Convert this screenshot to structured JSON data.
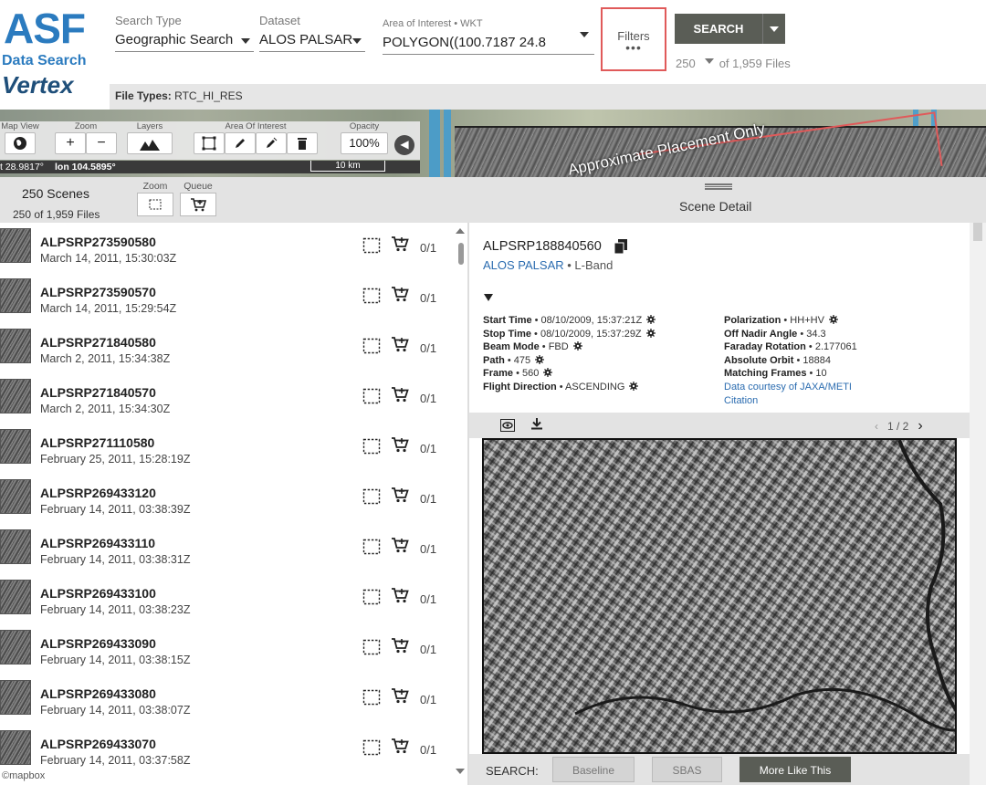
{
  "logo": {
    "asf": "ASF",
    "data_search": "Data Search",
    "vertex": "Vertex"
  },
  "header": {
    "search_type_label": "Search Type",
    "search_type_value": "Geographic Search",
    "dataset_label": "Dataset",
    "dataset_value": "ALOS PALSAR",
    "aoi_label": "Area of Interest • WKT",
    "aoi_value": "POLYGON((100.7187 24.8",
    "filters_label": "Filters",
    "filters_dots": "•••",
    "search_label": "SEARCH",
    "per_page": "250",
    "total_files": "of 1,959 Files",
    "file_types_label": "File Types:",
    "file_types_value": "RTC_HI_RES"
  },
  "map": {
    "toolbar_labels": {
      "map_view": "Map View",
      "zoom": "Zoom",
      "layers": "Layers",
      "aoi": "Area Of Interest",
      "opacity": "Opacity"
    },
    "zoom_in": "+",
    "zoom_out": "−",
    "opacity_value": "100%",
    "lat": "t 28.9817°",
    "lon": "lon 104.5895°",
    "scale": "10 km",
    "approx_text": "Approximate Placement Only"
  },
  "list_header": {
    "scene_count": "250 Scenes",
    "files_count": "250 of 1,959 Files",
    "zoom_label": "Zoom",
    "queue_label": "Queue",
    "detail_title": "Scene Detail"
  },
  "scenes": [
    {
      "name": "ALPSRP273590580",
      "date": "March 14, 2011, 15:30:03Z",
      "queue": "0/1"
    },
    {
      "name": "ALPSRP273590570",
      "date": "March 14, 2011, 15:29:54Z",
      "queue": "0/1"
    },
    {
      "name": "ALPSRP271840580",
      "date": "March 2, 2011, 15:34:38Z",
      "queue": "0/1"
    },
    {
      "name": "ALPSRP271840570",
      "date": "March 2, 2011, 15:34:30Z",
      "queue": "0/1"
    },
    {
      "name": "ALPSRP271110580",
      "date": "February 25, 2011, 15:28:19Z",
      "queue": "0/1"
    },
    {
      "name": "ALPSRP269433120",
      "date": "February 14, 2011, 03:38:39Z",
      "queue": "0/1"
    },
    {
      "name": "ALPSRP269433110",
      "date": "February 14, 2011, 03:38:31Z",
      "queue": "0/1"
    },
    {
      "name": "ALPSRP269433100",
      "date": "February 14, 2011, 03:38:23Z",
      "queue": "0/1"
    },
    {
      "name": "ALPSRP269433090",
      "date": "February 14, 2011, 03:38:15Z",
      "queue": "0/1"
    },
    {
      "name": "ALPSRP269433080",
      "date": "February 14, 2011, 03:38:07Z",
      "queue": "0/1"
    },
    {
      "name": "ALPSRP269433070",
      "date": "February 14, 2011, 03:37:58Z",
      "queue": "0/1"
    }
  ],
  "mapbox": "©mapbox",
  "detail": {
    "name": "ALPSRP188840560",
    "dataset": "ALOS PALSAR",
    "band": " • L-Band",
    "left": [
      {
        "k": "Start Time",
        "v": " • 08/10/2009, 15:37:21Z"
      },
      {
        "k": "Stop Time",
        "v": " • 08/10/2009, 15:37:29Z"
      },
      {
        "k": "Beam Mode",
        "v": " • FBD"
      },
      {
        "k": "Path",
        "v": " • 475"
      },
      {
        "k": "Frame",
        "v": " • 560"
      },
      {
        "k": "Flight Direction",
        "v": " • ASCENDING"
      }
    ],
    "right": [
      {
        "k": "Polarization",
        "v": " • HH+HV"
      },
      {
        "k": "Off Nadir Angle",
        "v": " • 34.3"
      },
      {
        "k": "Faraday Rotation",
        "v": " • 2.177061"
      },
      {
        "k": "Absolute Orbit",
        "v": " • 18884"
      },
      {
        "k": "Matching Frames",
        "v": " • 10"
      }
    ],
    "courtesy": "Data courtesy of JAXA/METI",
    "citation": "Citation",
    "pager": "1 / 2",
    "search_label": "SEARCH:",
    "baseline": "Baseline",
    "sbas": "SBAS",
    "more_like_this": "More Like This"
  },
  "colors": {
    "brand_blue": "#2b7bbf",
    "accent_red": "#e05a5a",
    "button_dark": "#5a5d56",
    "link": "#2b6cb0"
  }
}
